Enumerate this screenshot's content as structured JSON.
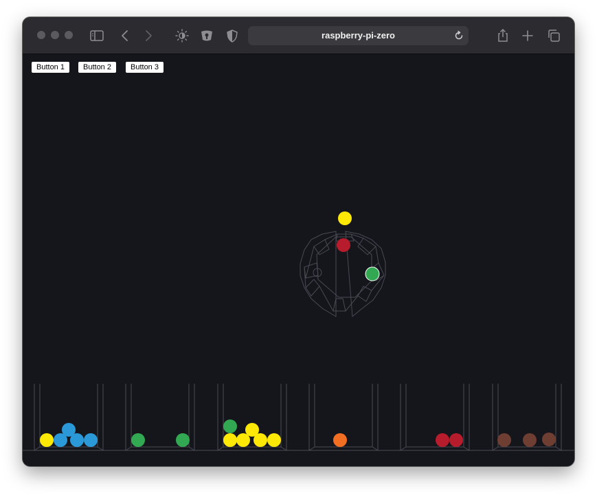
{
  "browser": {
    "address": "raspberry-pi-zero",
    "icons": [
      "sidebar-icon",
      "back-icon",
      "forward-icon",
      "brightness-icon",
      "shield-extension-icon",
      "privacy-shield-icon",
      "reload-icon",
      "share-icon",
      "new-tab-icon",
      "tab-overview-icon"
    ]
  },
  "page": {
    "buttons": [
      {
        "label": "Button 1"
      },
      {
        "label": "Button 2"
      },
      {
        "label": "Button 3"
      }
    ]
  },
  "colors": {
    "background": "#15151c",
    "yellow": "#fee806",
    "blue": "#2b99d8",
    "green": "#33a852",
    "orange": "#f26e22",
    "red": "#b71c2c",
    "brown": "#6e3e32",
    "outline": "#4a4a55"
  },
  "scene": {
    "wheel_balls": [
      "yellow",
      "red",
      "green"
    ],
    "bins": [
      {
        "balls": [
          "yellow",
          "blue",
          "blue",
          "blue",
          "blue"
        ]
      },
      {
        "balls": [
          "green",
          "green"
        ]
      },
      {
        "balls": [
          "green",
          "yellow",
          "yellow",
          "yellow",
          "yellow",
          "yellow"
        ]
      },
      {
        "balls": [
          "orange"
        ]
      },
      {
        "balls": [
          "red",
          "red"
        ]
      },
      {
        "balls": [
          "brown",
          "brown",
          "brown"
        ]
      }
    ]
  }
}
